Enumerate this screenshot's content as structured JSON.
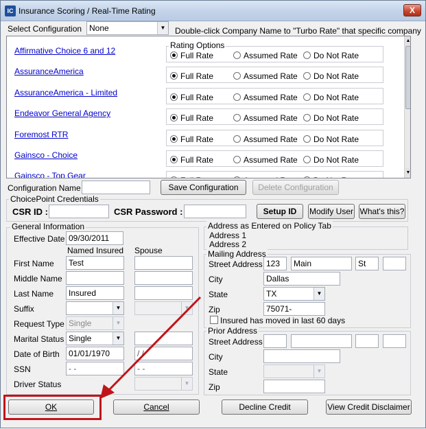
{
  "window": {
    "title": "Insurance Scoring / Real-Time Rating",
    "icon_text": "IC",
    "close_glyph": "X"
  },
  "config": {
    "select_label": "Select Configuration",
    "select_value": "None",
    "hint": "Double-click Company Name to \"Turbo Rate\" that specific company",
    "name_label": "Configuration Name",
    "name_value": "",
    "save_label": "Save Configuration",
    "delete_label": "Delete Configuration"
  },
  "rating": {
    "group_label": "Rating Options",
    "option_full": "Full Rate",
    "option_assumed": "Assumed Rate",
    "option_none": "Do Not Rate",
    "companies": [
      {
        "name": "Affirmative Choice 6 and 12",
        "selected": "full"
      },
      {
        "name": "AssuranceAmerica",
        "selected": "full"
      },
      {
        "name": "AssuranceAmerica - Limited",
        "selected": "full"
      },
      {
        "name": "Endeavor General Agency",
        "selected": "full"
      },
      {
        "name": "Foremost RTR",
        "selected": "full"
      },
      {
        "name": "Gainsco - Choice",
        "selected": "full"
      },
      {
        "name": "Gainsco - Top Gear",
        "selected": "full"
      }
    ]
  },
  "choicepoint": {
    "group_label": "ChoicePoint Credentials",
    "csr_id_label": "CSR ID :",
    "csr_id_value": "",
    "csr_password_label": "CSR Password :",
    "csr_password_value": "",
    "setup_id_label": "Setup ID",
    "modify_user_label": "Modify User",
    "whats_this_label": "What's this?"
  },
  "general": {
    "group_label": "General Information",
    "effective_date_label": "Effective Date",
    "effective_date_value": "09/30/2011",
    "col_named": "Named Insured",
    "col_spouse": "Spouse",
    "first_name_label": "First Name",
    "first_name_value": "Test",
    "middle_name_label": "Middle Name",
    "last_name_label": "Last Name",
    "last_name_value": "Insured",
    "suffix_label": "Suffix",
    "request_type_label": "Request Type",
    "request_type_value": "Single",
    "marital_status_label": "Marital Status",
    "marital_status_value": "Single",
    "dob_label": "Date of Birth",
    "dob_value": "01/01/1970",
    "spouse_dob_value": "/  /",
    "ssn_label": "SSN",
    "ssn_value": "-  -",
    "spouse_ssn_value": "-  -",
    "driver_status_label": "Driver Status"
  },
  "address_policy": {
    "group_label": "Address as Entered on Policy Tab",
    "line1": "Address 1",
    "line2": "Address 2"
  },
  "mailing": {
    "group_label": "Mailing Address",
    "street_label": "Street Address",
    "street_number": "123",
    "street_name": "Main",
    "street_type": "St",
    "street_unit": "",
    "city_label": "City",
    "city_value": "Dallas",
    "state_label": "State",
    "state_value": "TX",
    "zip_label": "Zip",
    "zip_value": "75071-",
    "moved_label": "Insured has moved in last 60 days"
  },
  "prior": {
    "group_label": "Prior Address",
    "street_label": "Street Address",
    "city_label": "City",
    "state_label": "State",
    "zip_label": "Zip"
  },
  "footer": {
    "ok_label": "OK",
    "cancel_label": "Cancel",
    "decline_label": "Decline Credit",
    "disclaimer_label": "View Credit Disclaimer"
  },
  "annotation": {
    "color": "#c0141a"
  }
}
